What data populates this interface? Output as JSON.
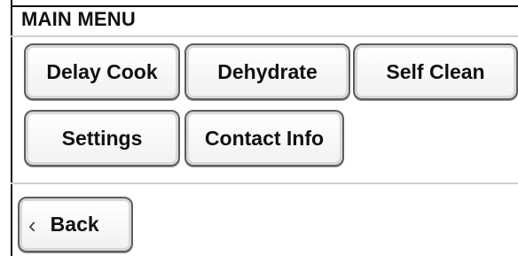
{
  "menu": {
    "title": "MAIN MENU",
    "buttons": {
      "delay_cook": "Delay Cook",
      "dehydrate": "Dehydrate",
      "self_clean": "Self Clean",
      "settings": "Settings",
      "contact_info": "Contact Info"
    },
    "back": {
      "label": "Back",
      "icon": "chevron-left-icon"
    }
  }
}
